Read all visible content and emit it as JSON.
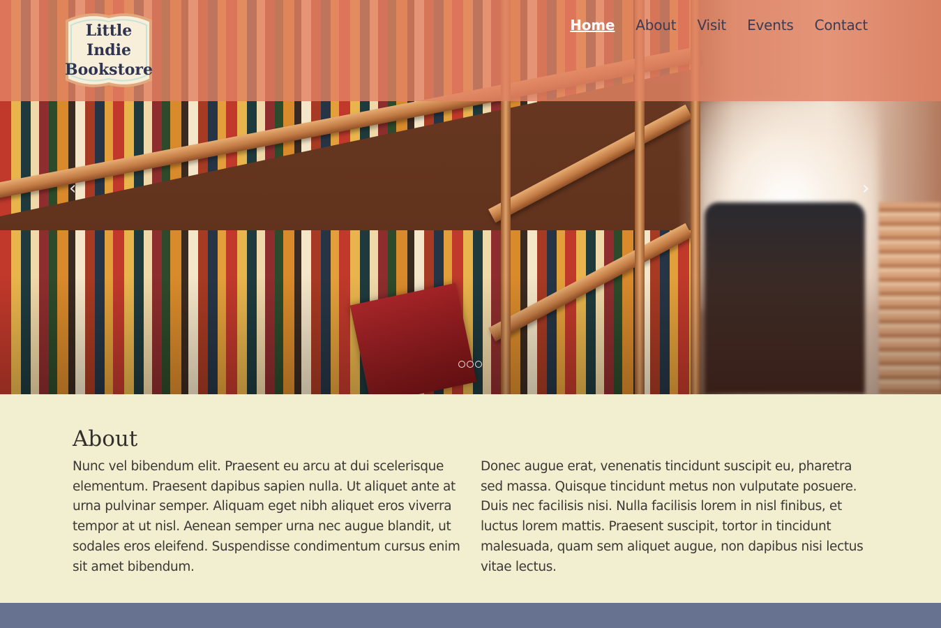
{
  "site": {
    "logo": {
      "lines": [
        "Little",
        "Indie",
        "Bookstore"
      ]
    },
    "nav": {
      "items": [
        {
          "label": "Home",
          "active": true
        },
        {
          "label": "About",
          "active": false
        },
        {
          "label": "Visit",
          "active": false
        },
        {
          "label": "Events",
          "active": false
        },
        {
          "label": "Contact",
          "active": false
        }
      ]
    }
  },
  "carousel": {
    "prev_glyph": "‹",
    "next_glyph": "›",
    "slide_count": 3
  },
  "about": {
    "title": "About",
    "left_text": "Nunc vel bibendum elit. Praesent eu arcu at dui scelerisque elementum. Praesent dapibus sapien nulla. Ut aliquet ante at urna pulvinar semper. Aliquam eget nibh aliquet eros viverra tempor at ut nisl. Aenean semper urna nec augue blandit, ut sodales eros eleifend. Suspendisse condimentum cursus enim sit amet bibendum.",
    "right_text": "Donec augue erat, venenatis tincidunt suscipit eu, pharetra sed massa. Quisque tincidunt metus non vulputate posuere. Duis nec facilisis nisi. Nulla facilisis lorem in nisl finibus, et luctus lorem mattis. Praesent suscipit, tortor in tincidunt malesuada, quam sem aliquet augue, non dapibus nisi lectus vitae lectus."
  },
  "colors": {
    "header_overlay": "#e28264",
    "about_bg": "#f2efd0",
    "footer_band": "#66728f",
    "logo_text": "#2f3550",
    "nav_text": "#3d3b52"
  }
}
